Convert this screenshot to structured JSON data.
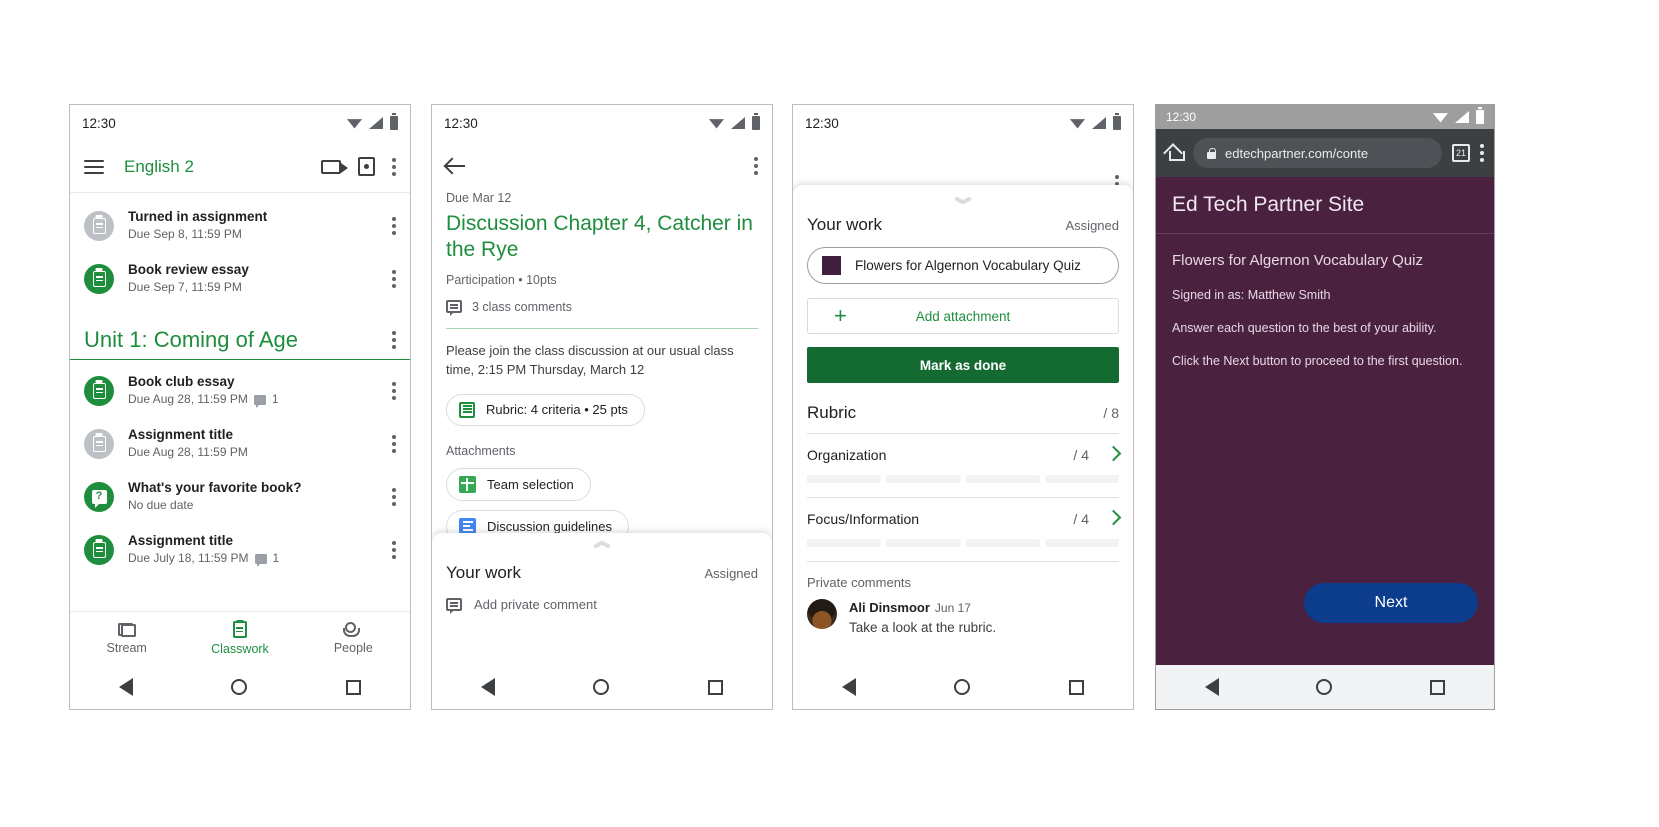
{
  "phone1": {
    "status": {
      "time": "12:30"
    },
    "appbar": {
      "title": "English 2",
      "menu_icon": "hamburger-icon",
      "meet_icon": "video-camera-icon",
      "calendar_icon": "calendar-icon",
      "overflow_icon": "more-vert-icon"
    },
    "top_items": [
      {
        "title": "Turned in assignment",
        "subtitle": "Due Sep 8, 11:59 PM",
        "state": "grey",
        "icon": "assignment-icon",
        "comments": ""
      },
      {
        "title": "Book review essay",
        "subtitle": "Due Sep 7, 11:59 PM",
        "state": "green",
        "icon": "assignment-icon",
        "comments": ""
      }
    ],
    "unit": {
      "title": "Unit 1: Coming of Age"
    },
    "unit_items": [
      {
        "title": "Book club essay",
        "subtitle": "Due Aug 28, 11:59 PM",
        "state": "green",
        "icon": "assignment-icon",
        "comments": "1"
      },
      {
        "title": "Assignment title",
        "subtitle": "Due Aug 28, 11:59 PM",
        "state": "grey",
        "icon": "assignment-icon",
        "comments": ""
      },
      {
        "title": "What's your favorite book?",
        "subtitle": "No due date",
        "state": "green",
        "icon": "question-icon",
        "comments": ""
      },
      {
        "title": "Assignment title",
        "subtitle": "Due July 18, 11:59 PM",
        "state": "green",
        "icon": "assignment-icon",
        "comments": "1"
      }
    ],
    "bottom_nav": [
      {
        "label": "Stream",
        "icon": "stream-icon",
        "active": false
      },
      {
        "label": "Classwork",
        "icon": "classwork-icon",
        "active": true
      },
      {
        "label": "People",
        "icon": "people-icon",
        "active": false
      }
    ]
  },
  "phone2": {
    "status": {
      "time": "12:30"
    },
    "appbar": {
      "back_icon": "back-arrow-icon",
      "overflow_icon": "more-vert-icon"
    },
    "due": "Due Mar 12",
    "title": "Discussion Chapter 4, Catcher in the Rye",
    "meta": "Participation • 10pts",
    "class_comments": "3 class comments",
    "description": "Please join the class discussion at our usual class time, 2:15 PM Thursday, March 12",
    "rubric_chip": "Rubric: 4 criteria • 25 pts",
    "attachments_label": "Attachments",
    "attachments": [
      {
        "label": "Team selection",
        "icon": "google-sheets-icon"
      },
      {
        "label": "Discussion guidelines",
        "icon": "google-docs-icon"
      }
    ],
    "your_work": {
      "title": "Your work",
      "status": "Assigned",
      "private_comment_placeholder": "Add private comment"
    }
  },
  "phone3": {
    "status": {
      "time": "12:30"
    },
    "appbar": {
      "overflow_icon": "more-vert-icon"
    },
    "your_work": {
      "title": "Your work",
      "status": "Assigned"
    },
    "attachment": {
      "label": "Flowers for Algernon Vocabulary Quiz",
      "swatch_color": "#3f1e3f"
    },
    "add_attachment": "Add attachment",
    "mark_as_done": "Mark as done",
    "rubric": {
      "title": "Rubric",
      "total": "/ 8"
    },
    "criteria": [
      {
        "name": "Organization",
        "score": "/ 4",
        "levels": 4
      },
      {
        "name": "Focus/Information",
        "score": "/ 4",
        "levels": 4
      }
    ],
    "private_comments": {
      "heading": "Private comments",
      "author": "Ali Dinsmoor",
      "date": "Jun 17",
      "text": "Take a look at the rubric."
    }
  },
  "phone4": {
    "status": {
      "time": "12:30"
    },
    "browser": {
      "home_icon": "home-icon",
      "lock_icon": "lock-icon",
      "url": "edtechpartner.com/conte",
      "tabs_icon": "tab-switcher-icon",
      "tab_count": "21",
      "overflow_icon": "more-vert-icon"
    },
    "site": {
      "header": "Ed Tech Partner Site",
      "quiz_title": "Flowers for Algernon Vocabulary Quiz",
      "lines": [
        "Signed in as: Matthew Smith",
        "Answer each question to the best of your ability.",
        "Click the Next button to proceed to the first question."
      ],
      "next_button": "Next",
      "bg_color": "#4a2240",
      "button_color": "#0b3d8c"
    }
  },
  "nav": {
    "back_icon": "nav-back-icon",
    "home_icon": "nav-home-icon",
    "recent_icon": "nav-recent-icon"
  }
}
